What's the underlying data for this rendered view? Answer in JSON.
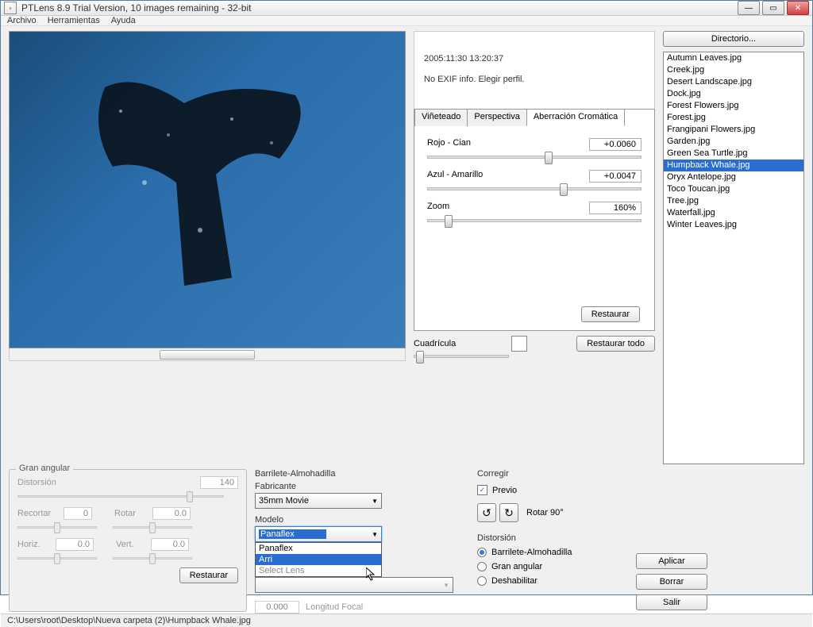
{
  "window": {
    "title": "PTLens 8.9 Trial Version, 10 images remaining - 32-bit"
  },
  "menu": {
    "archivo": "Archivo",
    "herramientas": "Herramientas",
    "ayuda": "Ayuda"
  },
  "exif": {
    "timestamp": "2005:11:30 13:20:37",
    "msg": "No EXIF info. Elegir perfil."
  },
  "tabs": {
    "vin": "Viñeteado",
    "persp": "Perspectiva",
    "aberr": "Aberración Cromática"
  },
  "sliders": {
    "rojo_label": "Rojo - Cian",
    "rojo_val": "+0.0060",
    "azul_label": "Azul - Amarillo",
    "azul_val": "+0.0047",
    "zoom_label": "Zoom",
    "zoom_val": "160%",
    "restore": "Restaurar"
  },
  "grid": {
    "label": "Cuadrícula",
    "restore_all": "Restaurar todo"
  },
  "right": {
    "dir_btn": "Directorio...",
    "files": [
      "Autumn Leaves.jpg",
      "Creek.jpg",
      "Desert Landscape.jpg",
      "Dock.jpg",
      "Forest Flowers.jpg",
      "Forest.jpg",
      "Frangipani Flowers.jpg",
      "Garden.jpg",
      "Green Sea Turtle.jpg",
      "Humpback Whale.jpg",
      "Oryx Antelope.jpg",
      "Toco Toucan.jpg",
      "Tree.jpg",
      "Waterfall.jpg",
      "Winter Leaves.jpg"
    ],
    "selected_index": 9
  },
  "ga": {
    "title": "Gran angular",
    "distorsion": "Distorsión",
    "distorsion_val": "140",
    "recortar": "Recortar",
    "recortar_val": "0",
    "rotar": "Rotar",
    "rotar_val": "0.0",
    "horiz": "Horiz.",
    "horiz_val": "0.0",
    "vert": "Vert.",
    "vert_val": "0.0",
    "restore": "Restaurar"
  },
  "ba": {
    "title": "Barrilete-Almohadilla",
    "fabricante": "Fabricante",
    "fabricante_val": "35mm Movie",
    "modelo": "Modelo",
    "modelo_val": "Panaflex",
    "modelo_opts": [
      "Panaflex",
      "Arri",
      "Select Lens"
    ],
    "focal_val": "0.000",
    "focal_ph": "Longitud Focal"
  },
  "cor": {
    "title": "Corregir",
    "previo": "Previo",
    "rotar90": "Rotar 90°",
    "distorsion": "Distorsión",
    "opt1": "Barrilete-Almohadilla",
    "opt2": "Gran angular",
    "opt3": "Deshabilitar"
  },
  "actions": {
    "aplicar": "Aplicar",
    "borrar": "Borrar",
    "salir": "Salir"
  },
  "status": "C:\\Users\\root\\Desktop\\Nueva carpeta (2)\\Humpback Whale.jpg"
}
